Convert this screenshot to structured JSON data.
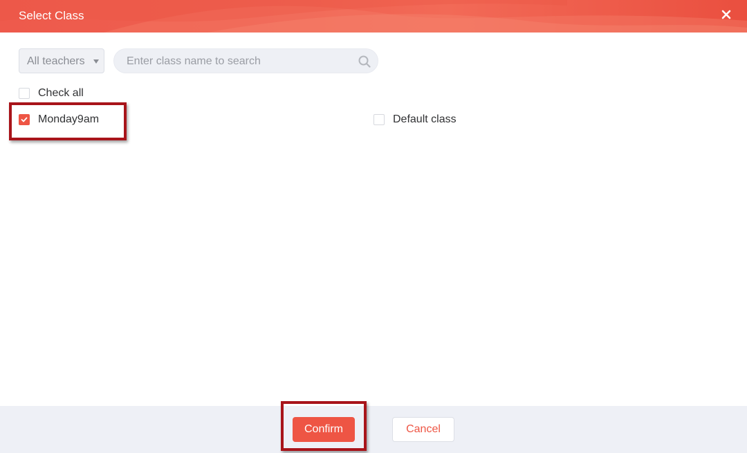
{
  "dialog": {
    "title": "Select Class",
    "close_icon": "close-icon",
    "accent_color": "#ee5544"
  },
  "filters": {
    "teacher_select": {
      "value": "All teachers"
    },
    "search": {
      "placeholder": "Enter class name to search",
      "value": "",
      "icon": "search-icon"
    }
  },
  "check_all": {
    "label": "Check all",
    "checked": false
  },
  "classes": [
    {
      "label": "Monday9am",
      "checked": true
    },
    {
      "label": "Default class",
      "checked": false
    }
  ],
  "footer": {
    "confirm_label": "Confirm",
    "cancel_label": "Cancel"
  }
}
